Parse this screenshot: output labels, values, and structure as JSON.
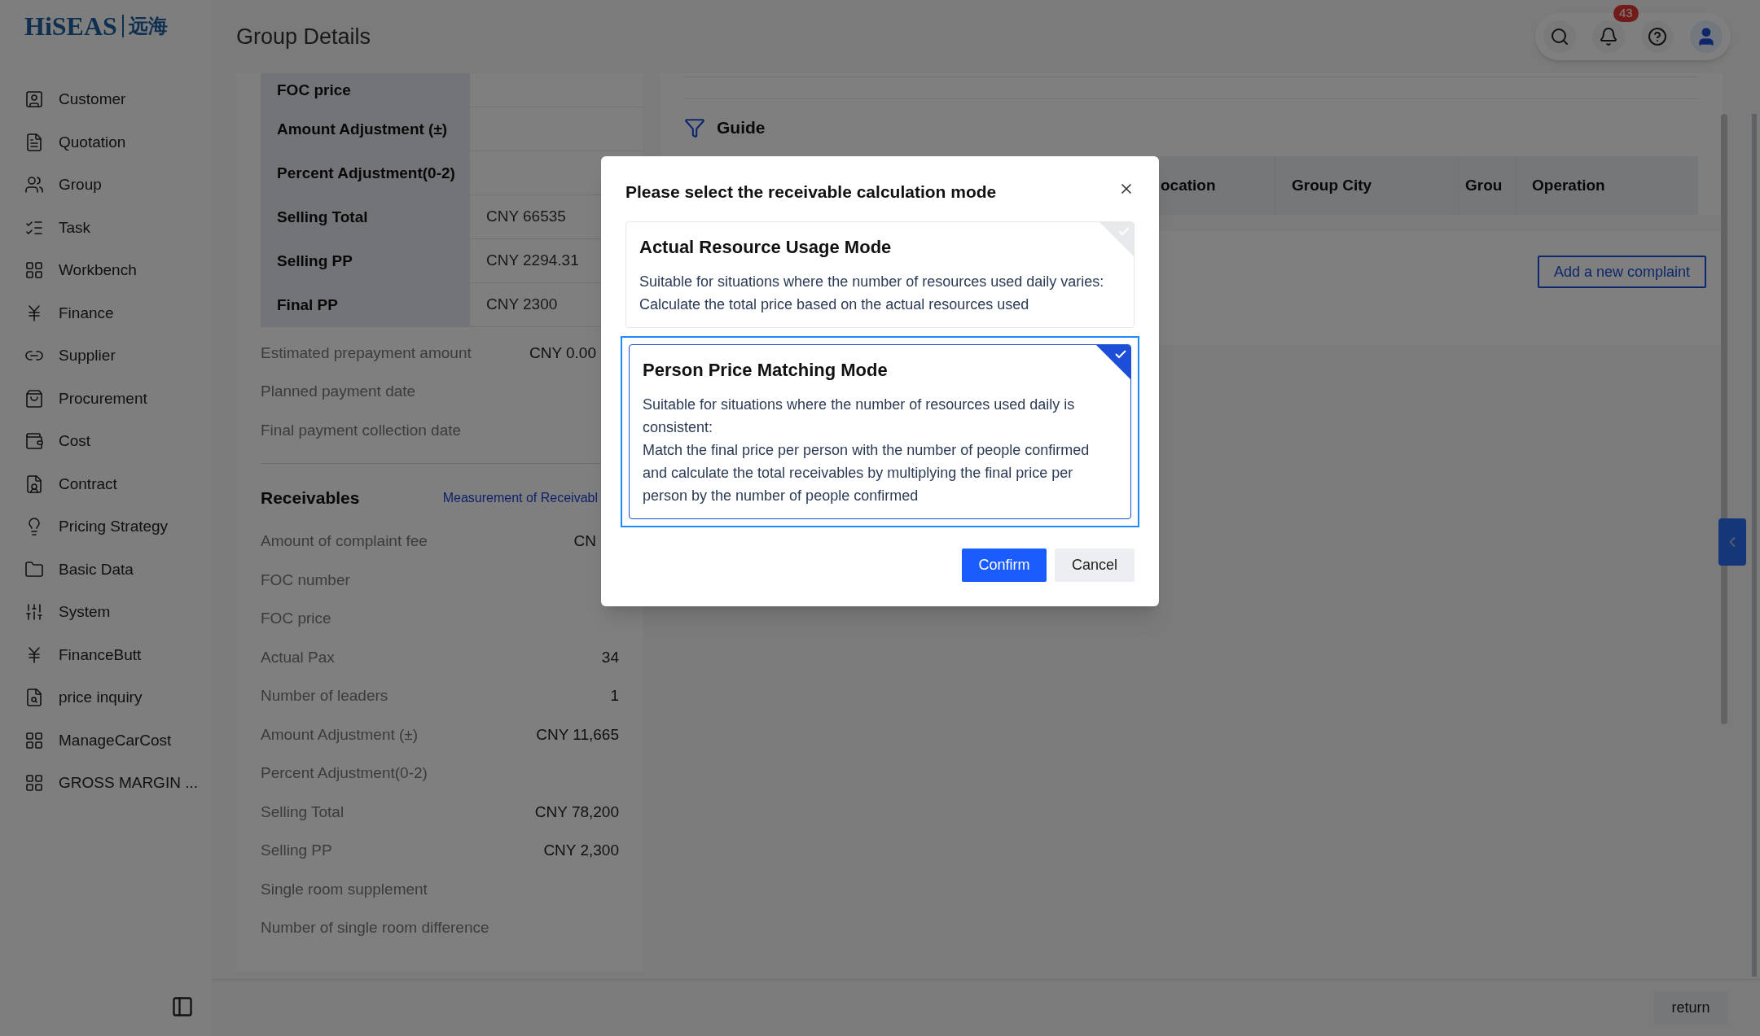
{
  "logo": {
    "latin": "HiSEAS",
    "chinese": "远海"
  },
  "page_title": "Group Details",
  "header": {
    "notification_count": "43"
  },
  "sidebar": {
    "items": [
      {
        "label": "Customer"
      },
      {
        "label": "Quotation"
      },
      {
        "label": "Group"
      },
      {
        "label": "Task"
      },
      {
        "label": "Workbench"
      },
      {
        "label": "Finance"
      },
      {
        "label": "Supplier"
      },
      {
        "label": "Procurement"
      },
      {
        "label": "Cost"
      },
      {
        "label": "Contract"
      },
      {
        "label": "Pricing Strategy"
      },
      {
        "label": "Basic Data"
      },
      {
        "label": "System"
      },
      {
        "label": "FinanceButt"
      },
      {
        "label": "price inquiry"
      },
      {
        "label": "ManageCarCost"
      },
      {
        "label": "GROSS MARGIN ..."
      }
    ]
  },
  "summary_table": {
    "rows": [
      {
        "label": "FOC price"
      },
      {
        "label": "Amount Adjustment (±)"
      },
      {
        "label": "Percent Adjustment(0-2)"
      },
      {
        "label": "Selling Total",
        "value": "CNY 66535"
      },
      {
        "label": "Selling PP",
        "value": "CNY 2294.31"
      },
      {
        "label": "Final PP",
        "value": "CNY 2300"
      }
    ]
  },
  "payment_fields": [
    {
      "label": "Estimated prepayment amount",
      "value": "CNY 0.00"
    },
    {
      "label": "Planned payment date"
    },
    {
      "label": "Final payment collection date"
    }
  ],
  "receivables": {
    "title": "Receivables",
    "link": "Measurement of Receivabl",
    "rows": [
      {
        "label": "Amount of complaint fee",
        "value": "CN"
      },
      {
        "label": "FOC number"
      },
      {
        "label": "FOC price"
      },
      {
        "label": "Actual Pax",
        "value": "34"
      },
      {
        "label": "Number of leaders",
        "value": "1"
      },
      {
        "label": "Amount Adjustment (±)",
        "value": "CNY 11,665"
      },
      {
        "label": "Percent Adjustment(0-2)"
      },
      {
        "label": "Selling Total",
        "value": "CNY 78,200"
      },
      {
        "label": "Selling PP",
        "value": "CNY 2,300"
      },
      {
        "label": "Single room supplement"
      },
      {
        "label": "Number of single room difference"
      }
    ]
  },
  "guide": {
    "title": "Guide",
    "columns": [
      "ocation",
      "Group City",
      "Grou",
      "Operation"
    ]
  },
  "complaints": {
    "add_button": "Add a new complaint"
  },
  "footer": {
    "return_button": "return"
  },
  "dialog": {
    "title": "Please select the receivable calculation mode",
    "options": [
      {
        "title": "Actual Resource Usage Mode",
        "description": "Suitable for situations where the number of resources used daily varies:\nCalculate the total price based on the actual resources used",
        "selected": false
      },
      {
        "title": "Person Price Matching Mode",
        "description": "Suitable for situations where the number of resources used daily is consistent:\nMatch the final price per person with the number of people confirmed and calculate the total receivables by multiplying the final price per person by the number of people confirmed",
        "selected": true
      }
    ],
    "confirm": "Confirm",
    "cancel": "Cancel"
  }
}
